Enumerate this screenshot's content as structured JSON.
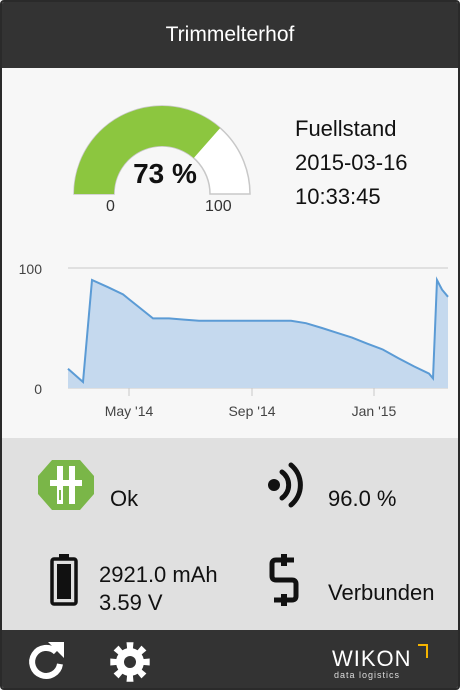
{
  "header": {
    "title": "Trimmelterhof"
  },
  "gauge": {
    "value": 73,
    "value_label": "73 %",
    "min_label": "0",
    "max_label": "100",
    "fill_color": "#8cc63f",
    "track_color": "#d0d0d0"
  },
  "info": {
    "label": "Fuellstand",
    "date": "2015-03-16",
    "time": "10:33:45"
  },
  "chart_data": {
    "type": "area",
    "y_ticks": [
      "100",
      "0"
    ],
    "ylim": [
      0,
      100
    ],
    "x_ticks": [
      "May '14",
      "Sep '14",
      "Jan '15"
    ],
    "x": [
      "2014-03-01",
      "2014-03-16",
      "2014-03-25",
      "2014-04-10",
      "2014-04-25",
      "2014-05-10",
      "2014-05-25",
      "2014-06-10",
      "2014-06-25",
      "2014-07-10",
      "2014-08-10",
      "2014-09-10",
      "2014-10-10",
      "2014-10-25",
      "2014-11-10",
      "2014-11-25",
      "2014-12-10",
      "2014-12-25",
      "2015-01-10",
      "2015-01-25",
      "2015-02-10",
      "2015-02-25",
      "2015-03-01",
      "2015-03-05",
      "2015-03-10",
      "2015-03-16"
    ],
    "values": [
      16,
      5,
      90,
      84,
      78,
      68,
      58,
      58,
      57,
      56,
      56,
      56,
      56,
      54,
      50,
      46,
      42,
      37,
      32,
      25,
      18,
      12,
      8,
      90,
      82,
      76
    ],
    "line_color": "#5b9bd5",
    "fill_color": "#c5d9ee",
    "grid": "horizontal"
  },
  "status": {
    "device_state": "Ok",
    "signal": "96.0 %",
    "battery_capacity": "2921.0 mAh",
    "battery_voltage": "3.59 V",
    "connection": "Verbunden",
    "icons": [
      "device-icon",
      "signal-icon",
      "battery-icon",
      "connection-icon"
    ],
    "device_icon_color": "#7ab648"
  },
  "footer": {
    "refresh_icon": "refresh-icon",
    "settings_icon": "gear-icon",
    "brand_name": "WIKON",
    "brand_sub": "data logistics",
    "brand_accent": "#f5b400"
  }
}
